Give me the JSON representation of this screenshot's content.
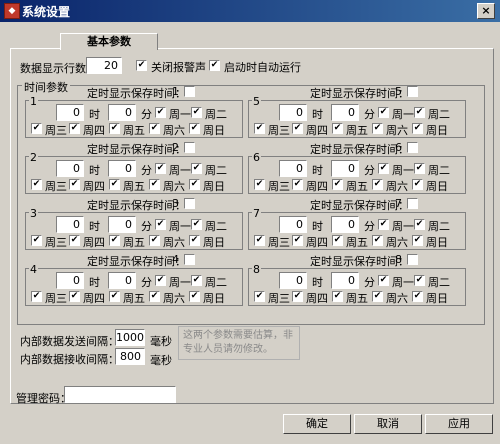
{
  "window": {
    "title": "系统设置",
    "close_label": "×"
  },
  "tab": {
    "label": "基本参数"
  },
  "general": {
    "rows_label": "数据显示行数",
    "rows_value": "20",
    "mute_label": "关闭报警声",
    "autostart_label": "启动时自动运行",
    "mute_checked": true,
    "autostart_checked": true
  },
  "time_group_label": "时间参数",
  "slot_title_prefix": "定时显示保存时间：",
  "hour_label": "时",
  "minute_label": "分",
  "weekdays": [
    "周一",
    "周二",
    "周三",
    "周四",
    "周五",
    "周六",
    "周日"
  ],
  "slots": [
    {
      "num": "1",
      "hour": "0",
      "minute": "0"
    },
    {
      "num": "2",
      "hour": "0",
      "minute": "0"
    },
    {
      "num": "3",
      "hour": "0",
      "minute": "0"
    },
    {
      "num": "4",
      "hour": "0",
      "minute": "0"
    },
    {
      "num": "5",
      "hour": "0",
      "minute": "0"
    },
    {
      "num": "6",
      "hour": "0",
      "minute": "0"
    },
    {
      "num": "7",
      "hour": "0",
      "minute": "0"
    },
    {
      "num": "8",
      "hour": "0",
      "minute": "0"
    }
  ],
  "intervals": {
    "send_label": "内部数据发送间隔：",
    "send_value": "1000",
    "recv_label": "内部数据接收间隔：",
    "recv_value": "800",
    "unit": "毫秒",
    "hint": "这两个参数需要估算，非专业人员请勿修改。"
  },
  "password_label": "管理密码：",
  "password_value": "",
  "buttons": {
    "ok": "确定",
    "cancel": "取消",
    "apply": "应用"
  }
}
